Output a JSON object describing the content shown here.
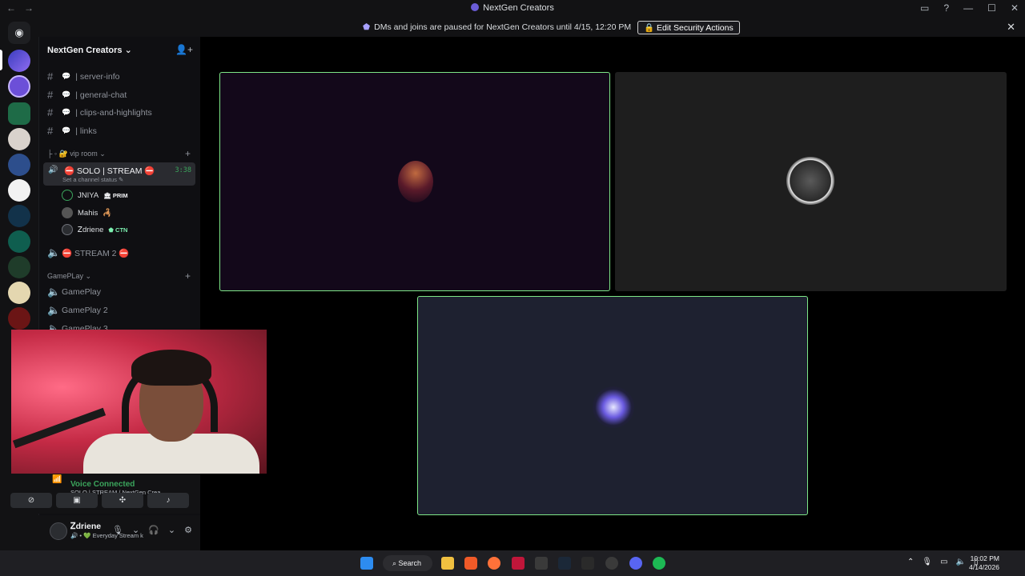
{
  "window": {
    "title": "NextGen Creators",
    "back": "←",
    "forward": "→",
    "controls": {
      "inbox": "▭",
      "help": "?",
      "minimize": "—",
      "maximize": "☐",
      "close": "✕"
    }
  },
  "notice": {
    "message": "DMs and joins are paused for NextGen Creators until 4/15, 12:20 PM",
    "button": "Edit Security Actions",
    "close": "✕"
  },
  "server": {
    "name": "NextGen Creators",
    "text_channels": [
      "| server-info",
      "| general-chat",
      "| clips-and-highlights",
      "| links"
    ],
    "vip_category": "vip room",
    "active_voice": {
      "name": "SOLO | STREAM",
      "timer": "3:38",
      "status_hint": "Set a channel status"
    },
    "voice_users": [
      {
        "name": "JNIYA",
        "tag": "PRIM"
      },
      {
        "name": "Mahis",
        "tag": ""
      },
      {
        "name": "Ꮓdriene",
        "tag": "CTN"
      }
    ],
    "other_voice": "STREAM 2",
    "gameplay_category": "GamePLay",
    "gameplay_channels": [
      "GamePlay",
      "GamePlay 2",
      "GamePlay 3"
    ]
  },
  "voice_panel": {
    "label": "Voice Connected",
    "channel_path": "SOLO | STREAM / NextGen Crea...",
    "buttons": [
      "video-off",
      "screen-share",
      "activities",
      "soundboard"
    ]
  },
  "user_panel": {
    "name": "Ꮓdriene",
    "status": "Everyday Stream k"
  },
  "taskbar": {
    "search_label": "Search",
    "time": "10:02 PM",
    "date": "4/14/2026"
  },
  "colors": {
    "speaking_green": "#3ba55c",
    "tile_border_active": "#7ee787"
  }
}
